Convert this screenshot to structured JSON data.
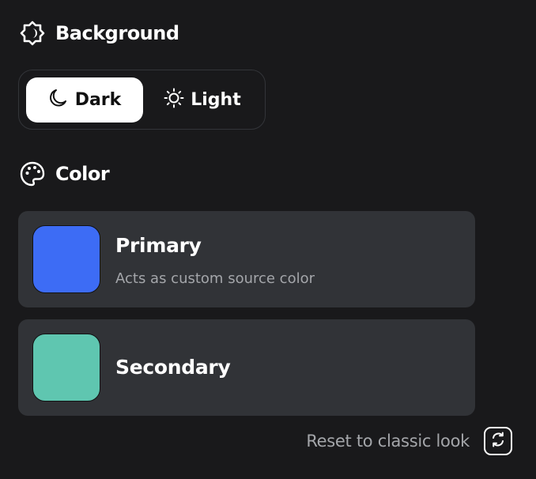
{
  "background_section": {
    "icon": "theme-badge-icon",
    "title": "Background",
    "options": [
      {
        "label": "Dark",
        "icon": "moon-icon",
        "selected": true
      },
      {
        "label": "Light",
        "icon": "sun-icon",
        "selected": false
      }
    ]
  },
  "color_section": {
    "icon": "palette-icon",
    "title": "Color",
    "cards": [
      {
        "title": "Primary",
        "subtitle": "Acts as custom source color",
        "swatch_color": "#3d6cf5"
      },
      {
        "title": "Secondary",
        "subtitle": "",
        "swatch_color": "#5fc6b0"
      }
    ]
  },
  "reset": {
    "label": "Reset to classic look",
    "icon": "refresh-icon"
  },
  "colors": {
    "page_background": "#19191b",
    "card_background": "#313337",
    "selected_toggle": "#ffffff",
    "muted_text": "#a4a6aa"
  }
}
